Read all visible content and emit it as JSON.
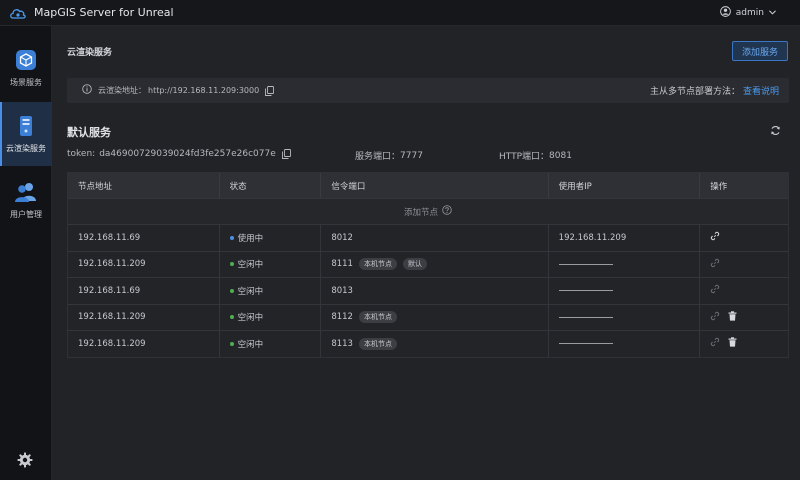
{
  "app": {
    "title": "MapGIS Server for Unreal"
  },
  "user": {
    "name": "admin"
  },
  "sidebar": {
    "items": [
      {
        "label": "场景服务",
        "icon": "cube-icon"
      },
      {
        "label": "云渲染服务",
        "icon": "server-icon"
      },
      {
        "label": "用户管理",
        "icon": "users-icon"
      }
    ]
  },
  "page": {
    "title": "云渲染服务",
    "add_button": "添加服务",
    "info_label": "云渲染地址：",
    "info_url": "http://192.168.11.209:3000",
    "deploy_text": "主从多节点部署方法：",
    "deploy_link": "查看说明"
  },
  "service": {
    "name": "默认服务",
    "token_label": "token:",
    "token": "da46900729039024fd3fe257e26c077e",
    "port_label": "服务端口：",
    "port": "7777",
    "http_label": "HTTP端口：",
    "http_port": "8081"
  },
  "table": {
    "headers": [
      "节点地址",
      "状态",
      "信令端口",
      "使用者IP",
      "操作"
    ],
    "add_node": "添加节点",
    "rows": [
      {
        "address": "192.168.11.69",
        "status": "使用中",
        "port": "8012",
        "tags": [],
        "user_ip": "192.168.11.209",
        "deletable": false
      },
      {
        "address": "192.168.11.209",
        "status": "空闲中",
        "port": "8111",
        "tags": [
          "本机节点",
          "默认"
        ],
        "user_ip": "",
        "deletable": false
      },
      {
        "address": "192.168.11.69",
        "status": "空闲中",
        "port": "8013",
        "tags": [],
        "user_ip": "",
        "deletable": false
      },
      {
        "address": "192.168.11.209",
        "status": "空闲中",
        "port": "8112",
        "tags": [
          "本机节点"
        ],
        "user_ip": "",
        "deletable": true
      },
      {
        "address": "192.168.11.209",
        "status": "空闲中",
        "port": "8113",
        "tags": [
          "本机节点"
        ],
        "user_ip": "",
        "deletable": true
      }
    ]
  },
  "colors": {
    "accent": "#4a9af0",
    "status_busy": "#4a8fe6",
    "status_idle": "#4caf50"
  }
}
